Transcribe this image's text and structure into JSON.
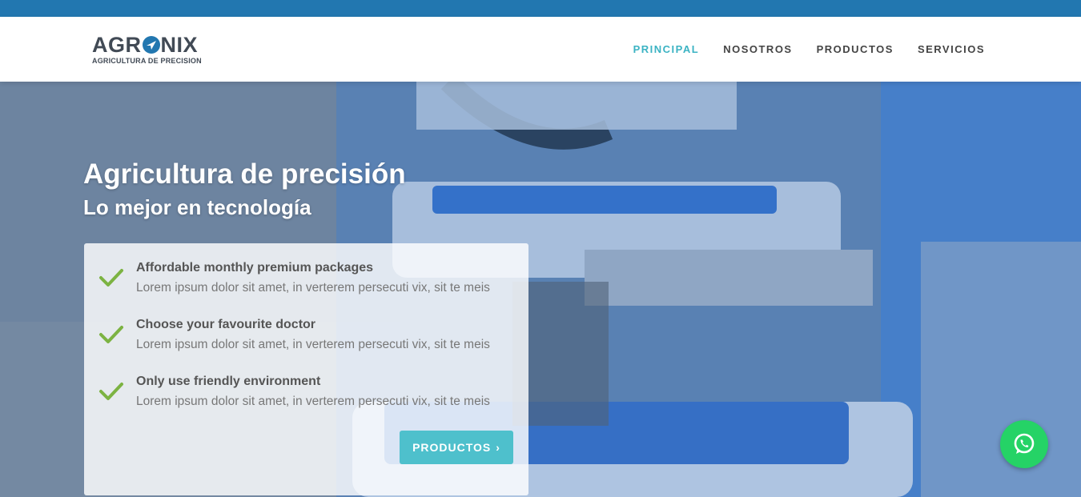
{
  "brand": {
    "name_part1": "AGR",
    "name_part2": "NIX",
    "tagline": "AGRICULTURA DE PRECISION",
    "primary_color": "#2277b0",
    "accent_color": "#4ec0cc"
  },
  "nav": {
    "items": [
      {
        "label": "PRINCIPAL",
        "active": true
      },
      {
        "label": "NOSOTROS",
        "active": false
      },
      {
        "label": "PRODUCTOS",
        "active": false
      },
      {
        "label": "SERVICIOS",
        "active": false
      }
    ]
  },
  "hero": {
    "title": "Agricultura de precisión",
    "subtitle": "Lo mejor en tecnología",
    "features": [
      {
        "title": "Affordable monthly premium packages",
        "description": "Lorem ipsum dolor sit amet, in verterem persecuti vix, sit te meis",
        "icon": "check-icon"
      },
      {
        "title": "Choose your favourite doctor",
        "description": "Lorem ipsum dolor sit amet, in verterem persecuti vix, sit te meis",
        "icon": "check-icon"
      },
      {
        "title": "Only use friendly environment",
        "description": "Lorem ipsum dolor sit amet, in verterem persecuti vix, sit te meis",
        "icon": "check-icon"
      }
    ],
    "cta_label": "PRODUCTOS",
    "cta_icon": "chevron-right-icon"
  },
  "floating": {
    "whatsapp_icon": "whatsapp-icon",
    "color": "#25d366"
  }
}
